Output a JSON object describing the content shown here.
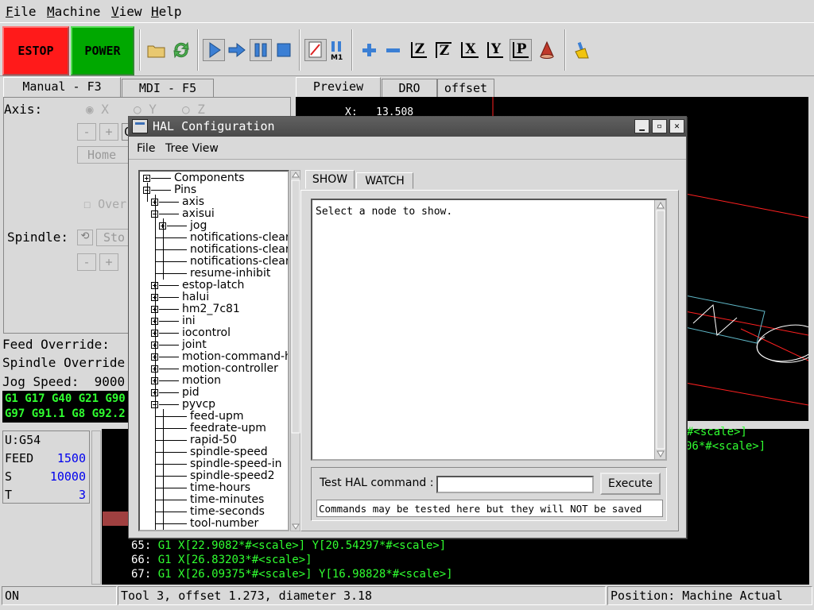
{
  "menubar": {
    "items": [
      {
        "first": "F",
        "rest": "ile"
      },
      {
        "first": "M",
        "rest": "achine"
      },
      {
        "first": "V",
        "rest": "iew"
      },
      {
        "first": "H",
        "rest": "elp"
      }
    ]
  },
  "toolbar": {
    "estop_label": "ESTOP",
    "power_label": "POWER",
    "estop_color": "#ff1a1a",
    "power_color": "#00a800",
    "icons": [
      "open-folder-icon",
      "reload-icon",
      "run-icon",
      "step-icon",
      "pause-icon",
      "stop-icon",
      "block-delete-icon",
      "optional-stop-icon",
      "zoom-in-icon",
      "zoom-out-icon",
      "view-z-icon",
      "view-z2-icon",
      "view-x-icon",
      "view-y-icon",
      "view-p-icon",
      "rotate-icon",
      "clear-live-plot-icon"
    ],
    "view_z": "Z",
    "view_z2": "Z",
    "view_x": "X",
    "view_y": "Y",
    "view_p": "P",
    "m1_label": "M1"
  },
  "left_tabs": {
    "manual": "Manual - F3",
    "mdi": "MDI - F5"
  },
  "manual": {
    "axis_label": "Axis:",
    "axis_x": "X",
    "axis_y": "Y",
    "axis_z": "Z",
    "minus": "-",
    "plus": "+",
    "jog_value": "C",
    "home_label": "Home",
    "override_label": "Over",
    "spindle_label": "Spindle:",
    "spindle_stop": "Sto",
    "spindle_minus": "-",
    "spindle_plus": "+"
  },
  "overrides": {
    "feed": "Feed Override:",
    "spindle": "Spindle Override",
    "jog": "Jog Speed:  9000"
  },
  "active_gcodes": {
    "line1": "G1 G17 G40 G21 G90",
    "line2": "G97 G91.1 G8 G92.2"
  },
  "status": {
    "u": "U:G54",
    "feed_label": "FEED",
    "feed_value": "1500",
    "s_label": "S",
    "s_value": "10000",
    "t_label": "T",
    "t_value": "3"
  },
  "right_tabs": {
    "preview": "Preview",
    "dro": "DRO",
    "offset": "offset"
  },
  "preview": {
    "x_label": "X:",
    "x_value": "13.508"
  },
  "program": {
    "partial1": "06*#<scale>]",
    "partial0": "#<scale>]",
    "lines": [
      {
        "num": "65:",
        "code": " G1 X[22.9082*#<scale>] Y[20.54297*#<scale>]"
      },
      {
        "num": "66:",
        "code": " G1 X[26.83203*#<scale>]"
      },
      {
        "num": "67:",
        "code": " G1 X[26.09375*#<scale>] Y[16.98828*#<scale>]"
      }
    ]
  },
  "statusbar": {
    "state": "ON",
    "tool": "Tool 3, offset 1.273, diameter 3.18",
    "position": "Position: Machine Actual"
  },
  "hal": {
    "title": "HAL Configuration",
    "menu_file": "File",
    "menu_tree": "Tree View",
    "tab_show": "SHOW",
    "tab_watch": "WATCH",
    "show_text": "Select a node to show.",
    "cmd_label": "Test HAL command :",
    "cmd_value": "",
    "exec_label": "Execute",
    "cmd_note": "Commands may be tested here but they will NOT be saved",
    "tree": [
      {
        "label": "Components",
        "level": 0,
        "box": "plus"
      },
      {
        "label": "Pins",
        "level": 0,
        "box": "minus"
      },
      {
        "label": "axis",
        "level": 1,
        "box": "plus"
      },
      {
        "label": "axisui",
        "level": 1,
        "box": "minus"
      },
      {
        "label": "jog",
        "level": 2,
        "box": "plus"
      },
      {
        "label": "notifications-clear",
        "level": 2,
        "box": "none"
      },
      {
        "label": "notifications-clear",
        "level": 2,
        "box": "none"
      },
      {
        "label": "notifications-clear",
        "level": 2,
        "box": "none"
      },
      {
        "label": "resume-inhibit",
        "level": 2,
        "box": "none"
      },
      {
        "label": "estop-latch",
        "level": 1,
        "box": "plus"
      },
      {
        "label": "halui",
        "level": 1,
        "box": "plus"
      },
      {
        "label": "hm2_7c81",
        "level": 1,
        "box": "plus"
      },
      {
        "label": "ini",
        "level": 1,
        "box": "plus"
      },
      {
        "label": "iocontrol",
        "level": 1,
        "box": "plus"
      },
      {
        "label": "joint",
        "level": 1,
        "box": "plus"
      },
      {
        "label": "motion-command-h",
        "level": 1,
        "box": "plus"
      },
      {
        "label": "motion-controller",
        "level": 1,
        "box": "plus"
      },
      {
        "label": "motion",
        "level": 1,
        "box": "plus"
      },
      {
        "label": "pid",
        "level": 1,
        "box": "plus"
      },
      {
        "label": "pyvcp",
        "level": 1,
        "box": "minus"
      },
      {
        "label": "feed-upm",
        "level": 2,
        "box": "none"
      },
      {
        "label": "feedrate-upm",
        "level": 2,
        "box": "none"
      },
      {
        "label": "rapid-50",
        "level": 2,
        "box": "none"
      },
      {
        "label": "spindle-speed",
        "level": 2,
        "box": "none"
      },
      {
        "label": "spindle-speed-in",
        "level": 2,
        "box": "none"
      },
      {
        "label": "spindle-speed2",
        "level": 2,
        "box": "none"
      },
      {
        "label": "time-hours",
        "level": 2,
        "box": "none"
      },
      {
        "label": "time-minutes",
        "level": 2,
        "box": "none"
      },
      {
        "label": "time-seconds",
        "level": 2,
        "box": "none"
      },
      {
        "label": "tool-number",
        "level": 2,
        "box": "none"
      }
    ]
  }
}
